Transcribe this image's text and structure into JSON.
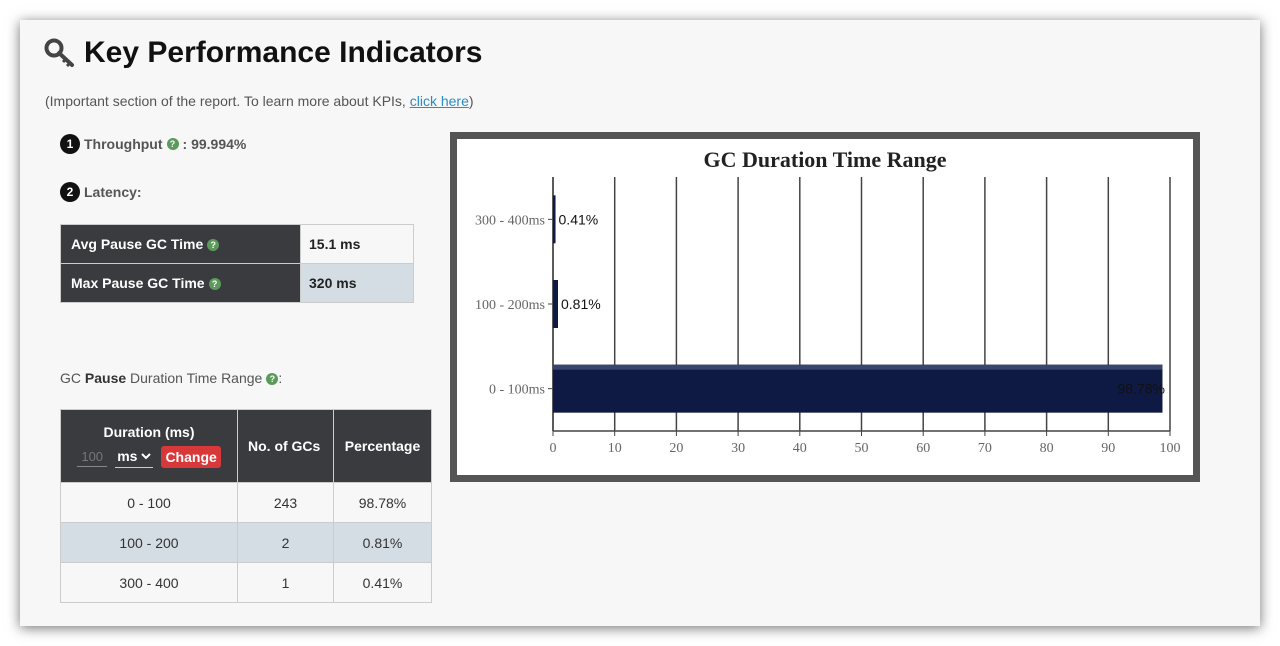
{
  "header": {
    "title": "Key Performance Indicators",
    "subtitle_prefix": "(Important section of the report. To learn more about KPIs, ",
    "subtitle_link": "click here",
    "subtitle_suffix": ")"
  },
  "throughput": {
    "number": "1",
    "label": "Throughput",
    "value": ": 99.994%"
  },
  "latency": {
    "number": "2",
    "label": "Latency:",
    "rows": [
      {
        "label": "Avg Pause GC Time",
        "value": "15.1 ms"
      },
      {
        "label": "Max Pause GC Time",
        "value": "320 ms"
      }
    ]
  },
  "pause_range": {
    "title_prefix": "GC ",
    "title_bold": "Pause",
    "title_suffix": " Duration Time Range",
    "colon": ":"
  },
  "gc_table": {
    "headers": {
      "duration": "Duration (ms)",
      "count": "No. of GCs",
      "percentage": "Percentage"
    },
    "controls": {
      "input_placeholder": "100",
      "unit": "ms",
      "change_label": "Change"
    },
    "rows": [
      {
        "range": "0 - 100",
        "count": "243",
        "percentage": "98.78%"
      },
      {
        "range": "100 - 200",
        "count": "2",
        "percentage": "0.81%"
      },
      {
        "range": "300 - 400",
        "count": "1",
        "percentage": "0.41%"
      }
    ]
  },
  "icons": {
    "title": "key-icon",
    "help": "question-circle-icon",
    "select": "chevron-down-icon"
  },
  "colors": {
    "bar": "#0e1a44",
    "header_bg": "#3a3b3f",
    "alt_row": "#d3dde3",
    "change_button": "#d9383a",
    "help_icon": "#5b9a5b"
  },
  "chart_data": {
    "type": "bar",
    "orientation": "horizontal",
    "title": "GC Duration Time Range",
    "categories": [
      "300 - 400ms",
      "100 - 200ms",
      "0 - 100ms"
    ],
    "values": [
      0.41,
      0.81,
      98.78
    ],
    "data_labels": [
      "0.41%",
      "0.81%",
      "98.78%"
    ],
    "xlim": [
      0,
      100
    ],
    "xticks": [
      "0",
      "10",
      "20",
      "30",
      "40",
      "50",
      "60",
      "70",
      "80",
      "90",
      "100"
    ],
    "grid": true
  }
}
